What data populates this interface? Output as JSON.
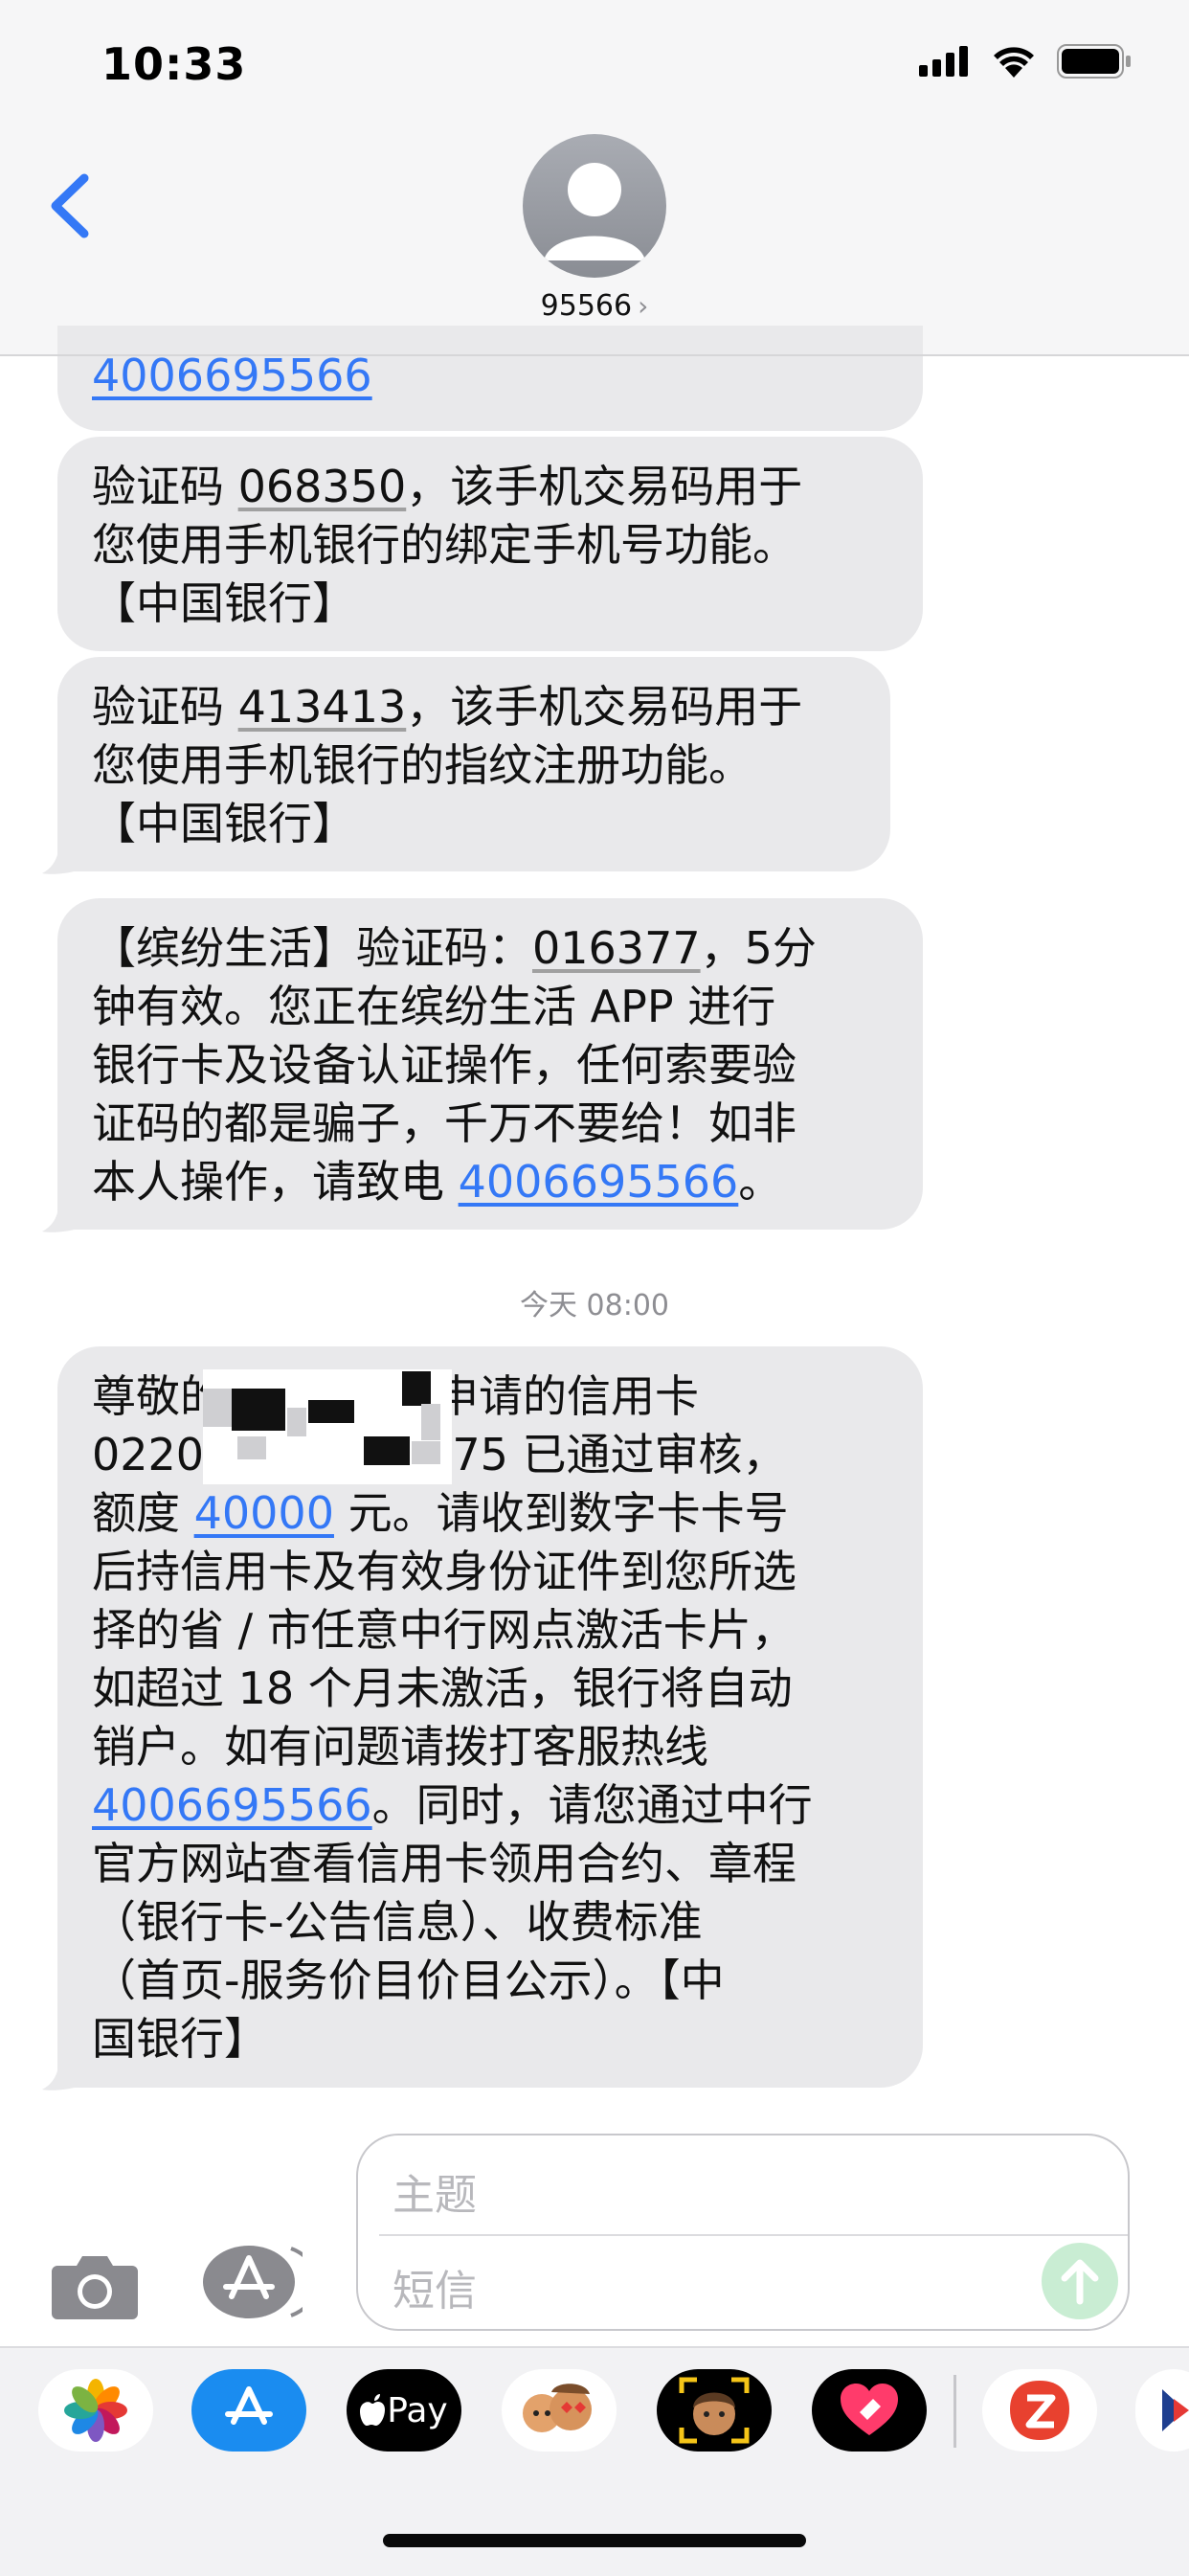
{
  "status_bar": {
    "time": "10:33"
  },
  "contact": {
    "name": "95566",
    "chevron": "›"
  },
  "messages": [
    {
      "line1": "4006695566"
    },
    {
      "p1": "验证码 ",
      "code": "068350",
      "p2": "，该手机交易码用于",
      "line2": "您使用手机银行的绑定手机号功能。",
      "line3": "【中国银行】"
    },
    {
      "p1": "验证码 ",
      "code": "413413",
      "p2": "，该手机交易码用于",
      "line2": "您使用手机银行的指纹注册功能。",
      "line3": "【中国银行】"
    },
    {
      "p1": "【缤纷生活】验证码：",
      "code": "016377",
      "p2": "，5分",
      "line2": "钟有效。您正在缤纷生活 APP 进行",
      "line3": "银行卡及设备认证操作，任何索要验",
      "line4": "证码的都是骗子，千万不要给！如非",
      "line5a": "本人操作，请致电 ",
      "phone": "4006695566",
      "line5b": "。"
    }
  ],
  "timestamp": "今天 08:00",
  "long_message": {
    "l1a": "尊敬的",
    "l1b": "申请的信用卡",
    "l2a": "0220",
    "l2b": "075 已通过审核，",
    "l3a": "额度 ",
    "amount": "40000",
    "l3b": " 元。请收到数字卡卡号",
    "l4": "后持信用卡及有效身份证件到您所选",
    "l5": "择的省 / 市任意中行网点激活卡片，",
    "l6": "如超过 18 个月未激活，银行将自动",
    "l7": "销户。如有问题请拨打客服热线",
    "phone": "4006695566",
    "l8b": "。同时，请您通过中行",
    "l9": "官方网站查看信用卡领用合约、章程",
    "l10": "（银行卡-公告信息）、收费标准",
    "l11": "（首页-服务价目价目公示）。【中",
    "l12": "国银行】"
  },
  "composer": {
    "subject_placeholder": "主题",
    "message_placeholder": "短信"
  },
  "app_strip": {
    "apps": [
      "photos-app",
      "app-store-app",
      "apple-pay-app",
      "memoji-stickers-app",
      "animoji-app",
      "digital-touch-app",
      "red-app",
      "partial-app"
    ],
    "apple_pay_label": "Pay"
  },
  "colors": {
    "link": "#3478f6",
    "bubble": "#e9e9eb",
    "send": "#c9edd3"
  }
}
